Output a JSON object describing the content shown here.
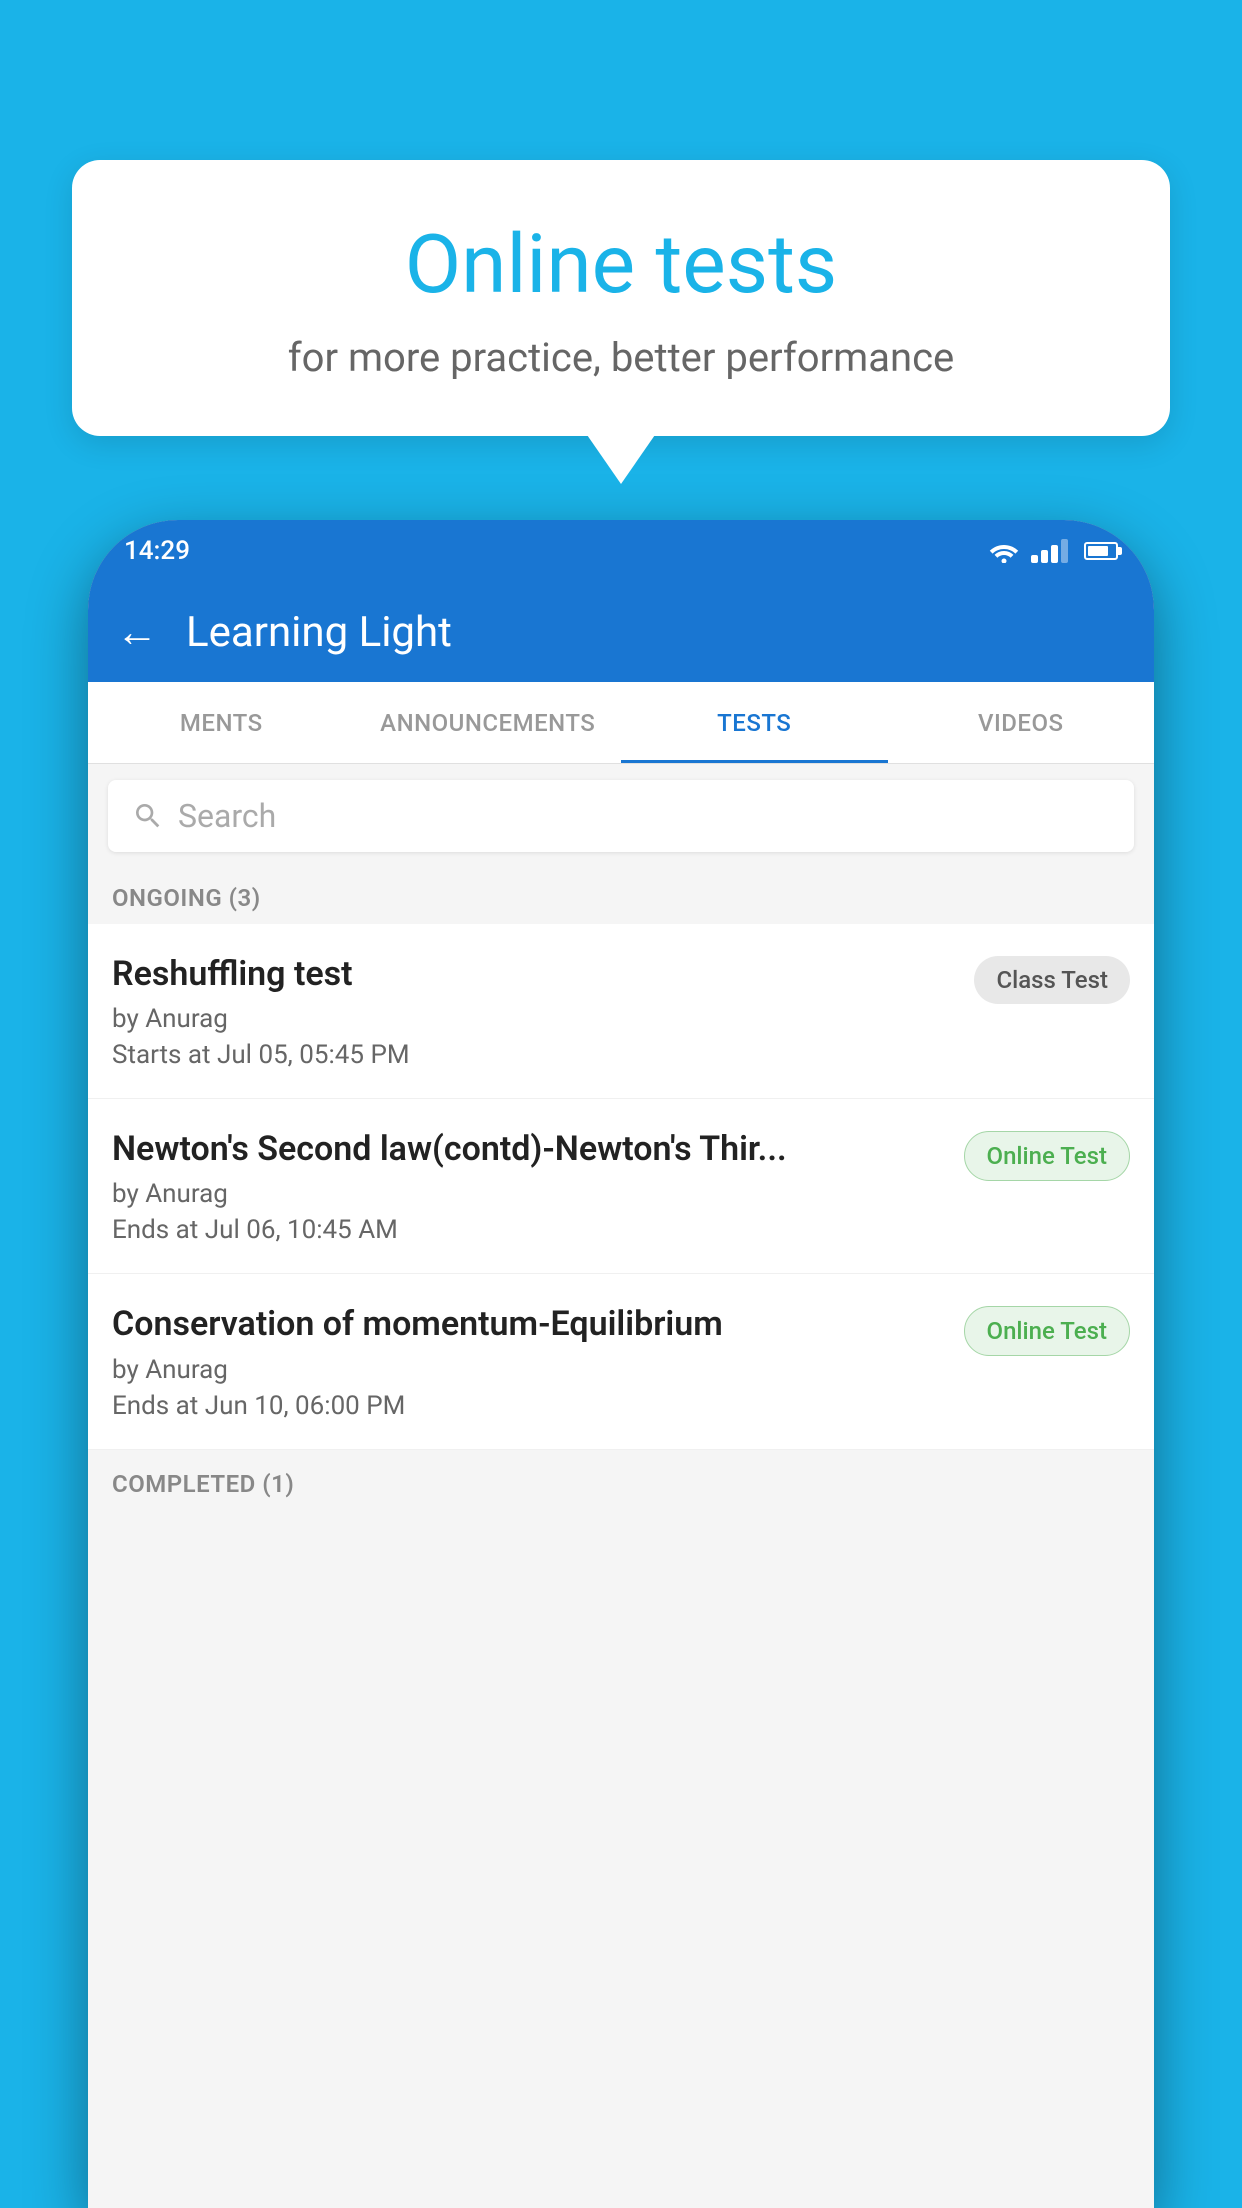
{
  "background": {
    "color": "#1ab3e8"
  },
  "bubble": {
    "title": "Online tests",
    "subtitle": "for more practice, better performance"
  },
  "status_bar": {
    "time": "14:29",
    "wifi_icon": "▾",
    "signal_label": "signal",
    "battery_label": "battery"
  },
  "app_bar": {
    "back_icon": "←",
    "title": "Learning Light"
  },
  "tabs": [
    {
      "label": "MENTS",
      "active": false
    },
    {
      "label": "ANNOUNCEMENTS",
      "active": false
    },
    {
      "label": "TESTS",
      "active": true
    },
    {
      "label": "VIDEOS",
      "active": false
    }
  ],
  "search": {
    "placeholder": "Search",
    "icon": "🔍"
  },
  "sections": {
    "ongoing": {
      "header": "ONGOING (3)",
      "items": [
        {
          "title": "Reshuffling test",
          "author": "by Anurag",
          "time": "Starts at  Jul 05, 05:45 PM",
          "badge": "Class Test",
          "badge_type": "class"
        },
        {
          "title": "Newton's Second law(contd)-Newton's Thir...",
          "author": "by Anurag",
          "time": "Ends at  Jul 06, 10:45 AM",
          "badge": "Online Test",
          "badge_type": "online"
        },
        {
          "title": "Conservation of momentum-Equilibrium",
          "author": "by Anurag",
          "time": "Ends at  Jun 10, 06:00 PM",
          "badge": "Online Test",
          "badge_type": "online"
        }
      ]
    },
    "completed": {
      "header": "COMPLETED (1)"
    }
  }
}
